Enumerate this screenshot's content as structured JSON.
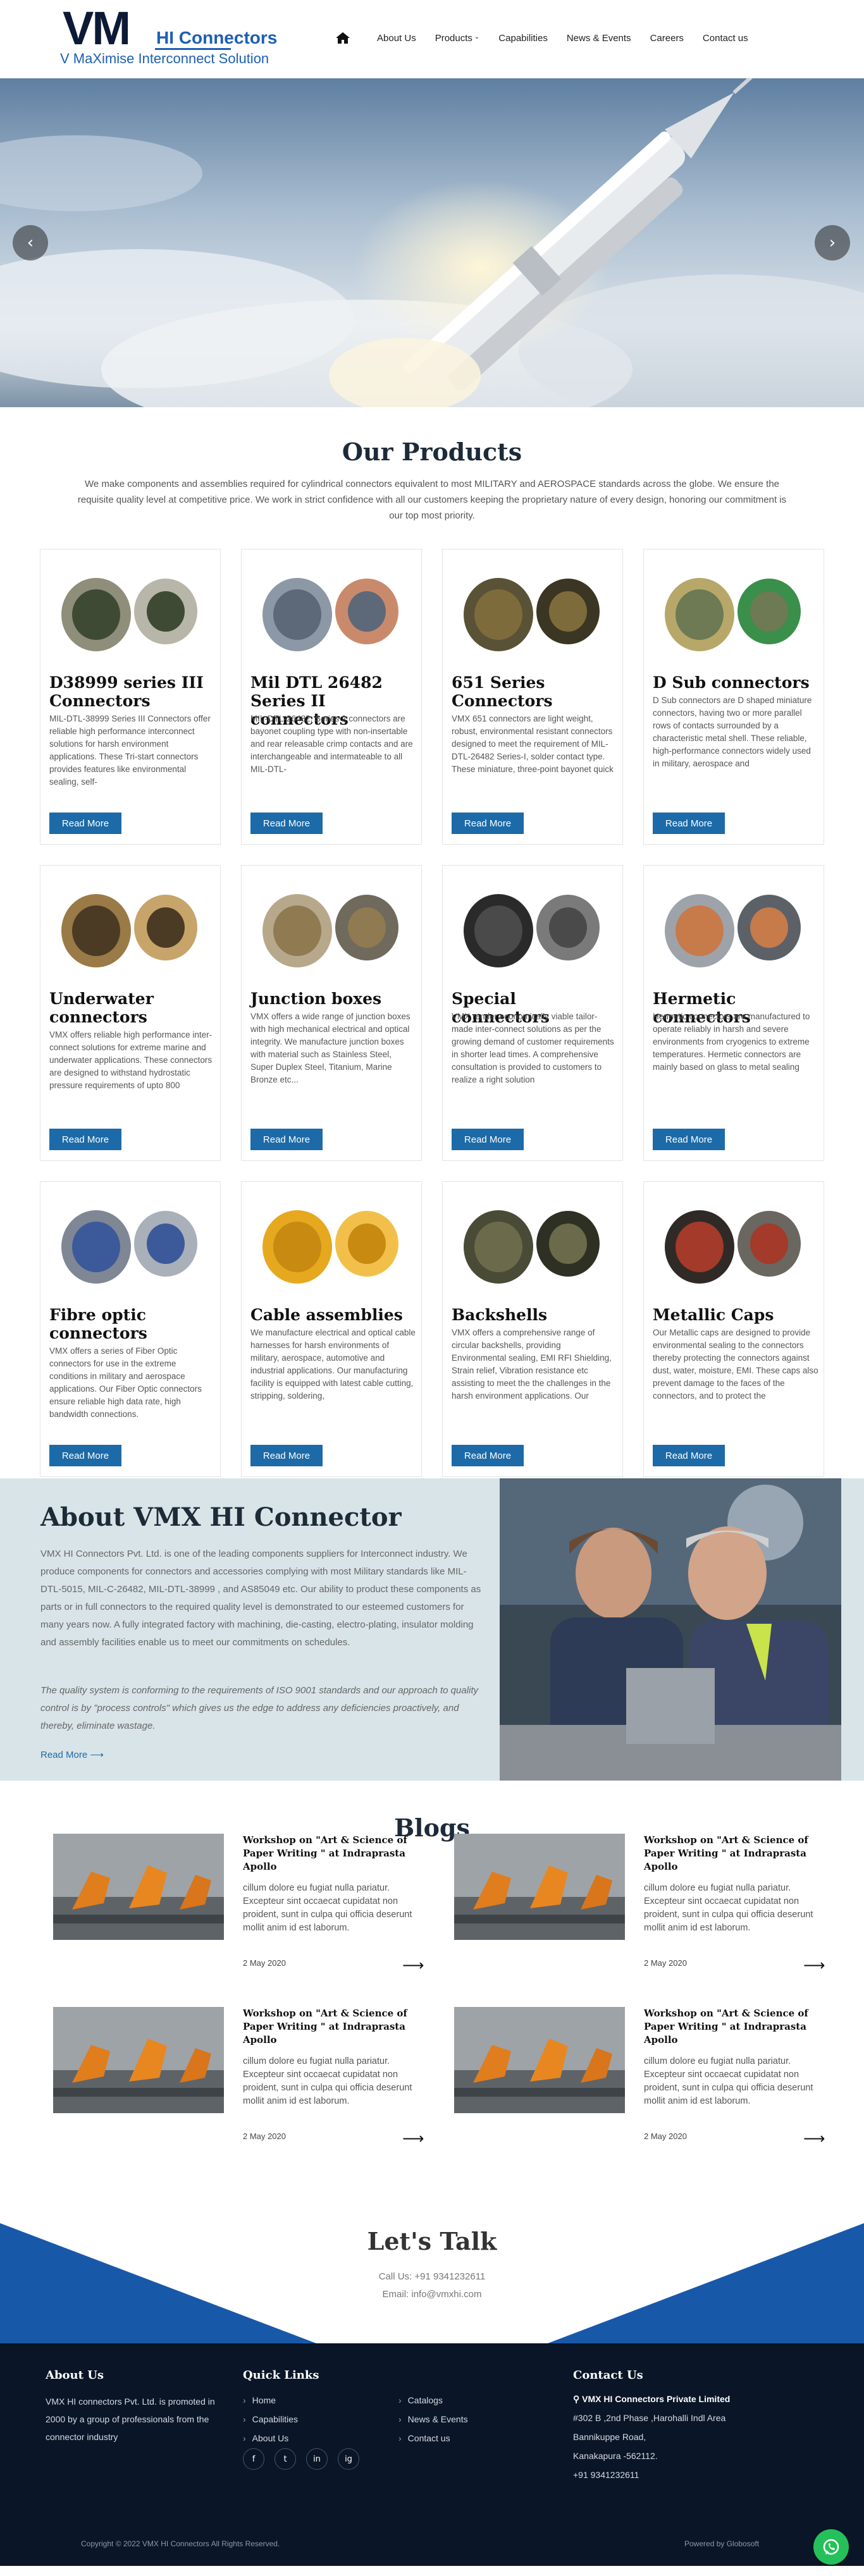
{
  "header": {
    "logo_letters": "VM",
    "logo_brand": "HI Connectors",
    "logo_tagline": "V MaXimise Interconnect Solution",
    "nav": [
      "About Us",
      "Products",
      "Capabilities",
      "News & Events",
      "Careers",
      "Contact us"
    ]
  },
  "products": {
    "title": "Our Products",
    "intro": "We make components and assemblies required for cylindrical connectors equivalent to most MILITARY and AEROSPACE standards across the globe. We ensure the requisite quality level at competitive price. We work in strict confidence with all our customers keeping the proprietary nature of every design, honoring our commitment is our top most priority.",
    "button_label": "Read More",
    "items": [
      {
        "title": "D38999 series III Connectors",
        "desc": "MIL-DTL-38999 Series III Connectors offer reliable high performance interconnect solutions for harsh environment applications. These Tri-start connectors provides features like environmental sealing, self-"
      },
      {
        "title": "Mil DTL 26482 Series II connectors",
        "desc": "MIL-DTL-26482, Series 2 connectors are bayonet coupling type with non-insertable and rear releasable crimp contacts and are interchangeable and intermateable to all MIL-DTL-"
      },
      {
        "title": "651 Series Connectors",
        "desc": "VMX 651 connectors are light weight, robust, environmental resistant connectors designed to meet the requirement of MIL-DTL-26482 Series-I, solder contact type. These miniature, three-point bayonet quick"
      },
      {
        "title": "D Sub connectors",
        "desc": "D Sub connectors are D shaped miniature connectors, having two or more parallel rows of contacts surrounded by a characteristic metal shell. These reliable, high-performance connectors widely used in military, aerospace and"
      },
      {
        "title": "Underwater connectors",
        "desc": "VMX offers reliable high performance inter-connect solutions for extreme marine and underwater applications.  These connectors are designed to withstand hydrostatic pressure requirements of upto 800"
      },
      {
        "title": "Junction boxes",
        "desc": "VMX offers a wide range of junction boxes with high mechanical electrical and optical integrity. We manufacture junction boxes with material such as Stainless Steel, Super Duplex Steel, Titanium, Marine Bronze etc..."
      },
      {
        "title": "Special connectors",
        "desc": "VMX render economically viable tailor-made inter-connect solutions as per the growing demand of customer requirements in shorter lead times.  A comprehensive consultation is provided to customers to realize a right solution"
      },
      {
        "title": "Hermetic connectors",
        "desc": "Hermetic connectors are manufactured to operate reliably in harsh and severe environments from cryogenics to extreme temperatures. Hermetic connectors are mainly based on glass to metal sealing"
      },
      {
        "title": "Fibre optic connectors",
        "desc": "VMX offers a series of Fiber Optic connectors for use in the extreme conditions in military and aerospace applications. Our Fiber Optic connectors ensure reliable high data rate, high bandwidth connections."
      },
      {
        "title": "Cable assemblies",
        "desc": "We manufacture electrical and optical cable harnesses for harsh environments of military, aerospace, automotive and industrial applications. Our manufacturing facility is equipped with latest cable cutting, stripping, soldering,"
      },
      {
        "title": "Backshells",
        "desc": "VMX offers a comprehensive range of circular backshells, providing Environmental sealing, EMI RFI Shielding, Strain relief, Vibration resistance etc assisting to meet the the challenges in the harsh environment applications. Our"
      },
      {
        "title": "Metallic Caps",
        "desc": "Our Metallic caps are designed to provide environmental sealing to the connectors thereby protecting the connectors against dust, water, moisture, EMI. These caps also prevent damage to the faces of the connectors, and to protect the"
      }
    ]
  },
  "about": {
    "title": "About VMX HI Connector",
    "p1": "VMX HI Connectors Pvt. Ltd. is one of the leading components suppliers for Interconnect industry. We produce components for connectors and accessories complying with most Military standards like MIL-DTL-5015, MIL-C-26482, MIL-DTL-38999 , and AS85049 etc. Our ability to product these components as parts or in full connectors to the required quality level is demonstrated to our esteemed customers for many years now. A fully integrated factory with machining, die-casting, electro-plating, insulator molding and assembly facilities enable us to meet our commitments on schedules.",
    "p2": "The quality system is conforming to the requirements of ISO 9001 standards and our approach to quality control is by \"process controls\" which gives us the edge to address any deficiencies proactively, and thereby, eliminate wastage.",
    "more": "Read More"
  },
  "blogs": {
    "title": "Blogs",
    "items": [
      {
        "title": "Workshop on \"Art & Science of Paper Writing \" at Indraprasta Apollo",
        "desc": "cillum dolore eu fugiat nulla pariatur. Excepteur sint occaecat cupidatat non proident, sunt in culpa qui officia deserunt mollit anim id est laborum.",
        "date": "2 May 2020"
      },
      {
        "title": "Workshop on \"Art & Science of Paper Writing \" at Indraprasta Apollo",
        "desc": "cillum dolore eu fugiat nulla pariatur. Excepteur sint occaecat cupidatat non proident, sunt in culpa qui officia deserunt mollit anim id est laborum.",
        "date": "2 May 2020"
      },
      {
        "title": "Workshop on \"Art & Science of Paper Writing \" at Indraprasta Apollo",
        "desc": "cillum dolore eu fugiat nulla pariatur. Excepteur sint occaecat cupidatat non proident, sunt in culpa qui officia deserunt mollit anim id est laborum.",
        "date": "2 May 2020"
      },
      {
        "title": "Workshop on \"Art & Science of Paper Writing \" at Indraprasta Apollo",
        "desc": "cillum dolore eu fugiat nulla pariatur. Excepteur sint occaecat cupidatat non proident, sunt in culpa qui officia deserunt mollit anim id est laborum.",
        "date": "2 May 2020"
      }
    ]
  },
  "talk": {
    "title": "Let's Talk",
    "phone": "Call Us: +91 9341232611",
    "email": "Email: info@vmxhi.com"
  },
  "footer": {
    "about_title": "About Us",
    "about_text": "VMX HI connectors Pvt. Ltd. is promoted in 2000 by a group of professionals from the connector industry",
    "links_title": "Quick Links",
    "links_col1": [
      "Home",
      "Capabilities",
      "About Us"
    ],
    "links_col2": [
      "Catalogs",
      "News & Events",
      "Contact us"
    ],
    "social": [
      "f",
      "t",
      "in",
      "ig"
    ],
    "contact_title": "Contact Us",
    "company": "VMX HI Connectors Private Limited",
    "address1": "#302 B ,2nd Phase ,Harohalli Indl Area",
    "address2": "Bannikuppe Road,",
    "address3": "Kanakapura -562112.",
    "phone": "+91 9341232611",
    "copyright": "Copyright © 2022 VMX HI Connectors All Rights Reserved.",
    "powered": "Powered by Globosoft"
  }
}
